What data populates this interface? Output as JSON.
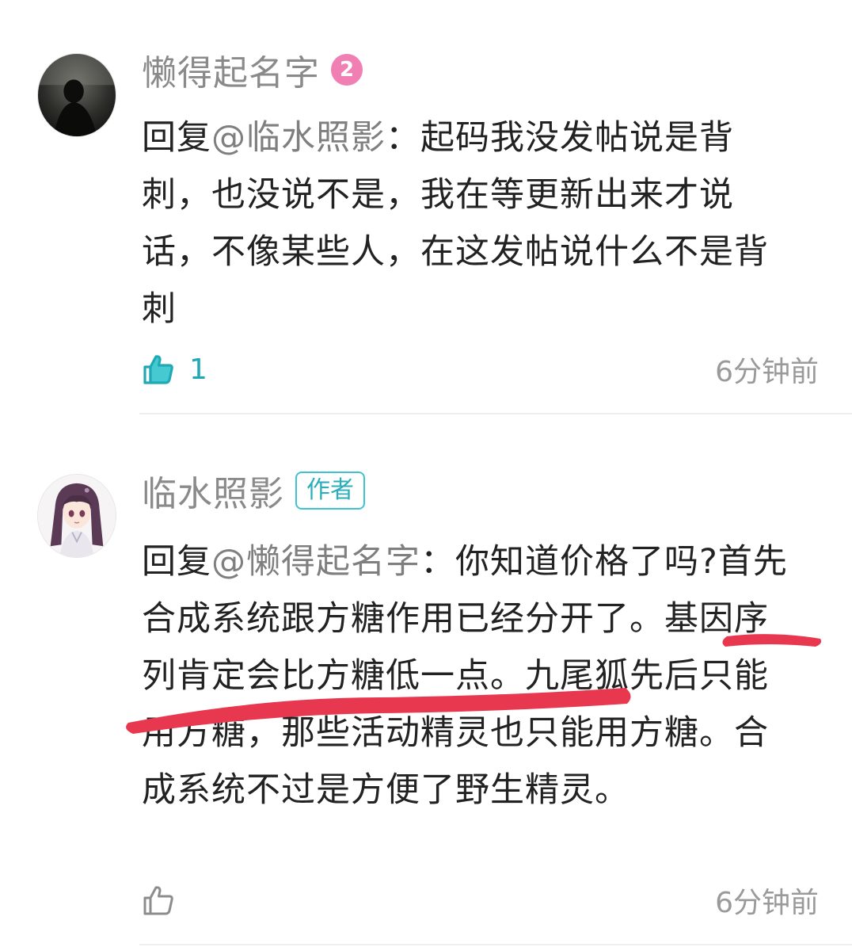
{
  "comments": [
    {
      "username": "懒得起名字",
      "level": "2",
      "reply_prefix": "回复",
      "mention": "@临水照影",
      "text": "：起码我没发帖说是背刺，也没说不是，我在等更新出来才说话，不像某些人，在这发帖说什么不是背刺",
      "like_count": "1",
      "liked": true,
      "timestamp": "6分钟前"
    },
    {
      "username": "临水照影",
      "author_tag": "作者",
      "reply_prefix": "回复",
      "mention": "@懒得起名字",
      "text": "：你知道价格了吗?首先合成系统跟方糖作用已经分开了。基因序列肯定会比方糖低一点。九尾狐先后只能用方糖，那些活动精灵也只能用方糖。合成系统不过是方便了野生精灵。",
      "liked": false,
      "timestamp": "6分钟前"
    }
  ],
  "colors": {
    "accent": "#1fa9b5",
    "level_badge": "#f07fb3",
    "markup_stroke": "#e8384f",
    "username": "#8a8a8a"
  },
  "icons": {
    "like_active": "thumbs-up-filled-icon",
    "like_inactive": "thumbs-up-outline-icon"
  }
}
